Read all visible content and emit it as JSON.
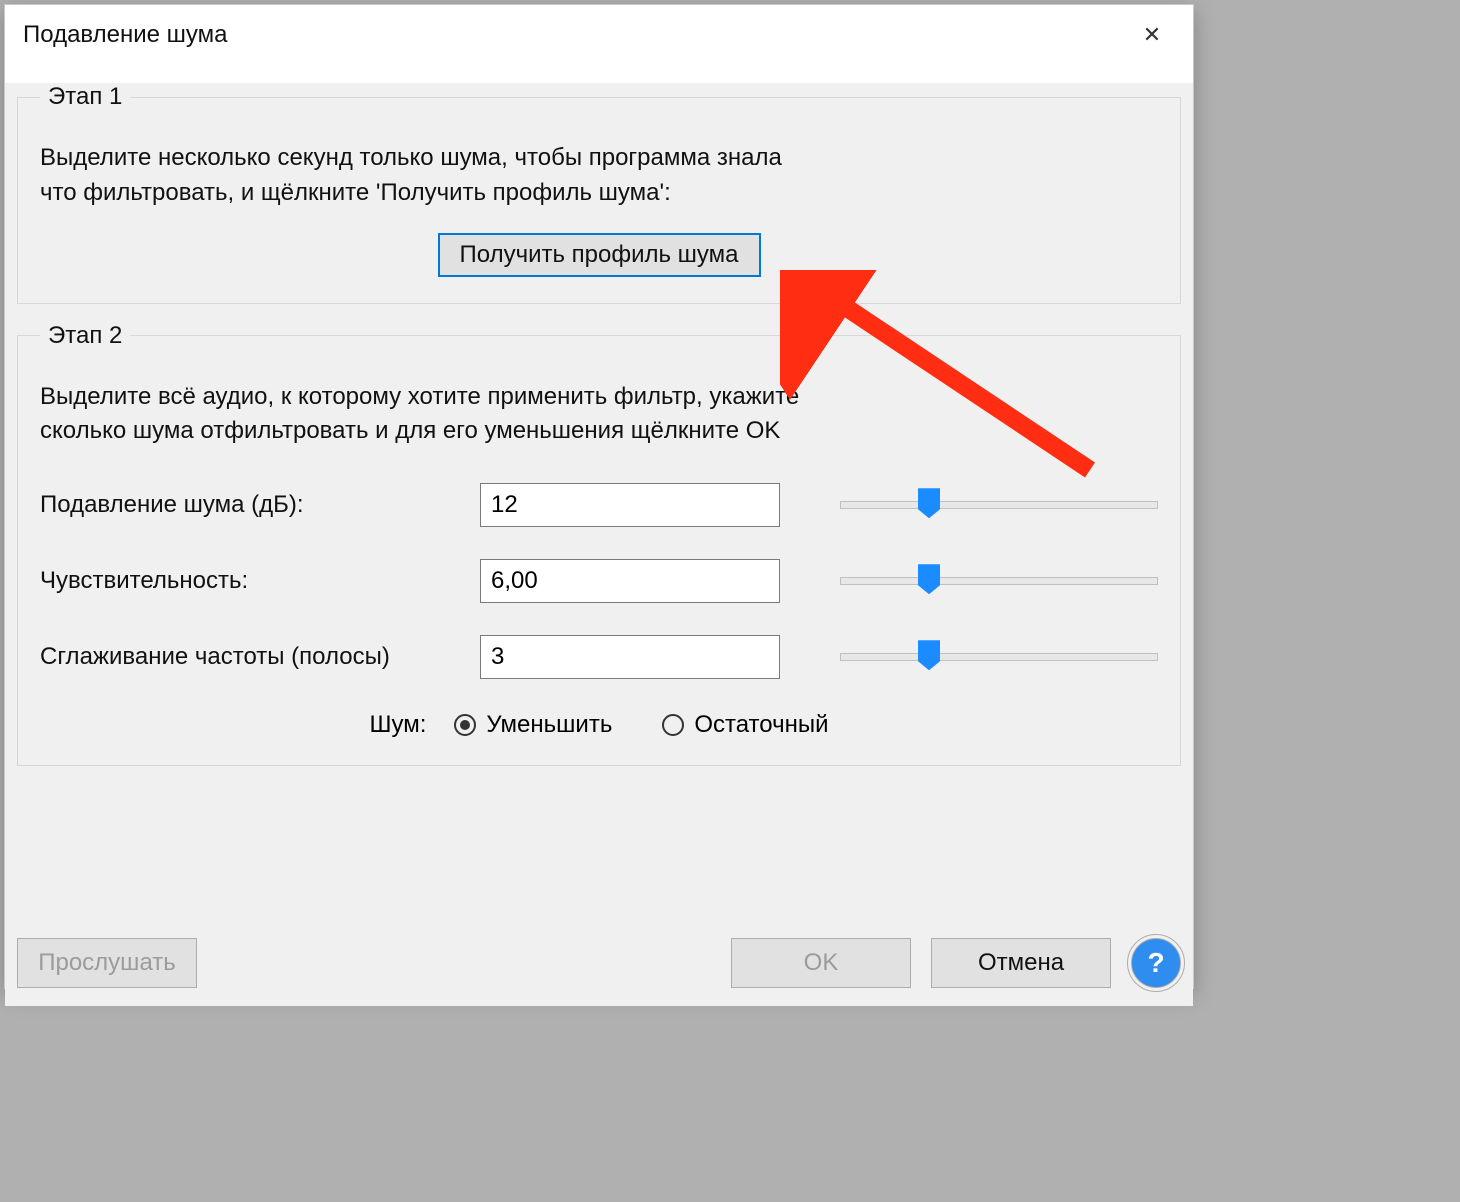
{
  "dialog": {
    "title": "Подавление шума"
  },
  "step1": {
    "legend": "Этап 1",
    "text": "Выделите несколько секунд только шума, чтобы программа знала\nчто фильтровать, и щёлкните 'Получить профиль шума':",
    "button": "Получить профиль шума"
  },
  "step2": {
    "legend": "Этап 2",
    "text": "Выделите всё аудио, к которому хотите применить фильтр, укажите\nсколько шума отфильтровать и для его уменьшения щёлкните OK",
    "params": {
      "noise_reduction": {
        "label": "Подавление шума (дБ):",
        "value": "12",
        "slider_pos": 0.28
      },
      "sensitivity": {
        "label": "Чувствительность:",
        "value": "6,00",
        "slider_pos": 0.28
      },
      "freq_smoothing": {
        "label": "Сглаживание частоты (полосы)",
        "value": "3",
        "slider_pos": 0.28
      }
    },
    "noise": {
      "lead": "Шум:",
      "opt_reduce": "Уменьшить",
      "opt_residual": "Остаточный",
      "selected": "reduce"
    }
  },
  "footer": {
    "preview": "Прослушать",
    "ok": "OK",
    "cancel": "Отмена",
    "help": "?"
  }
}
